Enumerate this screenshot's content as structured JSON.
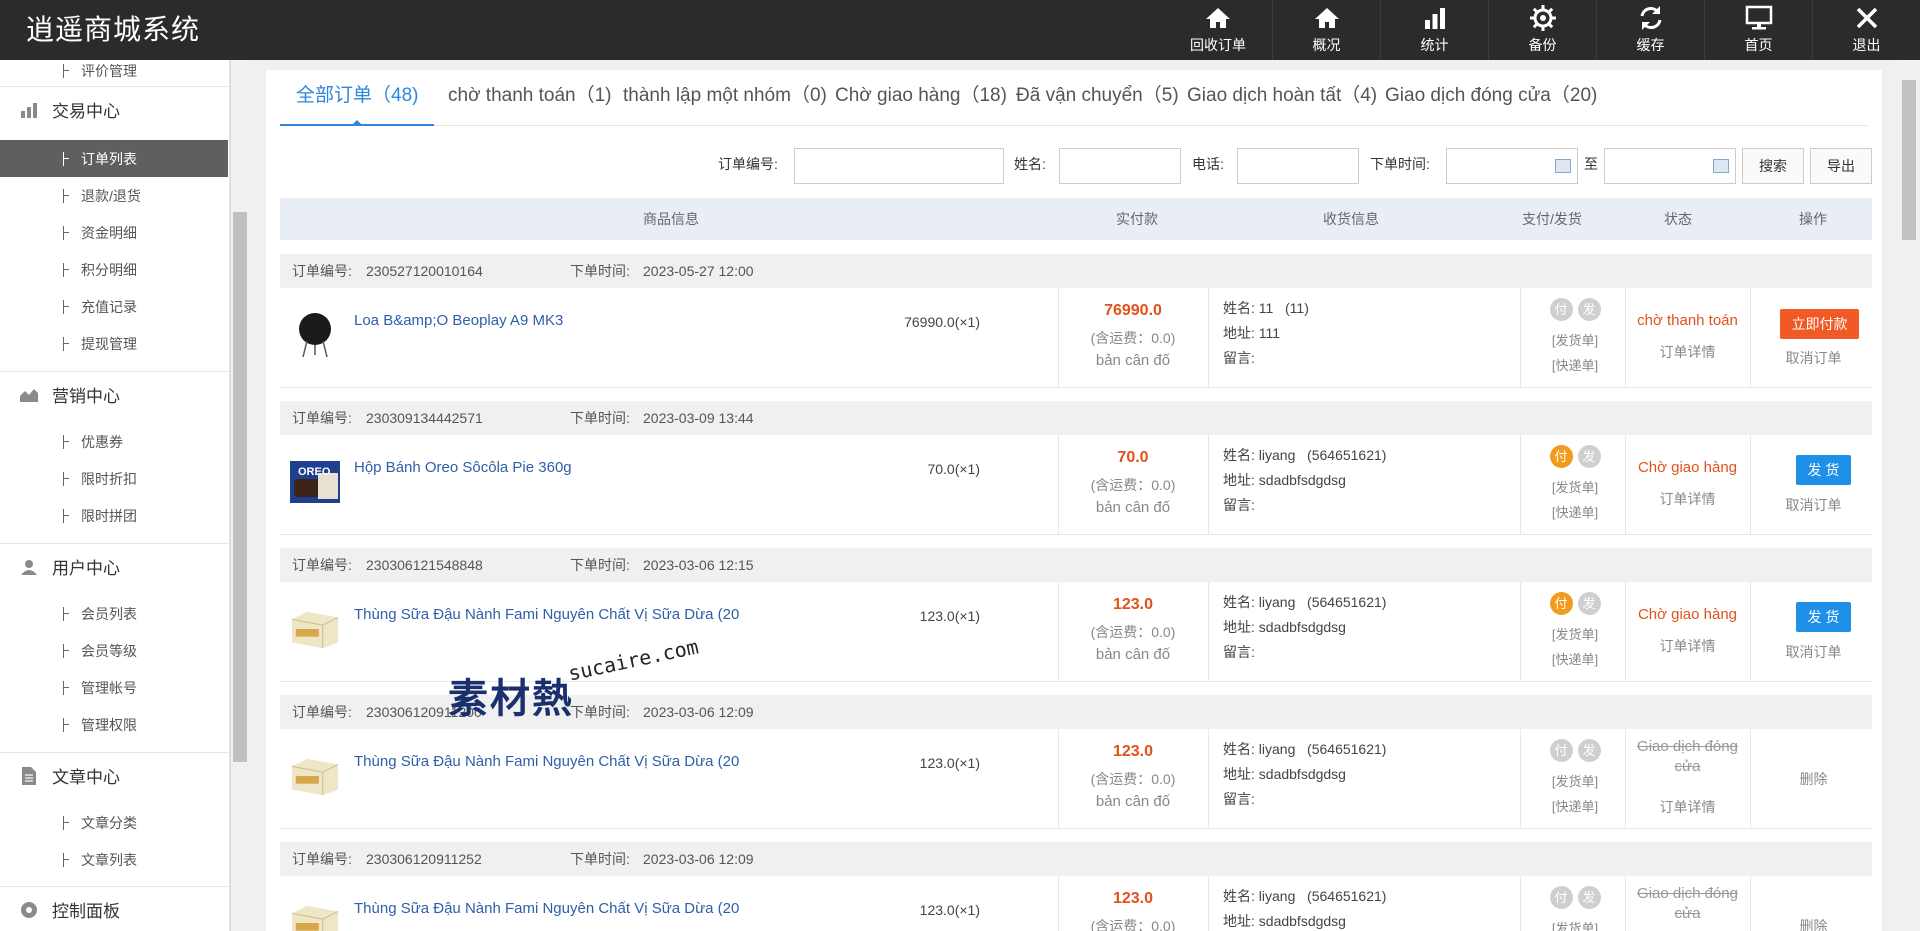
{
  "header": {
    "title": "逍遥商城系统",
    "nav": [
      {
        "label": "回收订单",
        "icon": "home-icon"
      },
      {
        "label": "概况",
        "icon": "home-icon"
      },
      {
        "label": "统计",
        "icon": "bar-chart-icon"
      },
      {
        "label": "备份",
        "icon": "gear-icon"
      },
      {
        "label": "缓存",
        "icon": "refresh-icon"
      },
      {
        "label": "首页",
        "icon": "monitor-icon"
      },
      {
        "label": "退出",
        "icon": "close-icon"
      }
    ]
  },
  "sidebar": {
    "cut_item": "评价管理",
    "groups": [
      {
        "label": "交易中心",
        "icon": "bar-chart-icon",
        "items": [
          "订单列表",
          "退款/退货",
          "资金明细",
          "积分明细",
          "充值记录",
          "提现管理"
        ]
      },
      {
        "label": "营销中心",
        "icon": "area-chart-icon",
        "items": [
          "优惠券",
          "限时折扣",
          "限时拼团"
        ]
      },
      {
        "label": "用户中心",
        "icon": "user-icon",
        "items": [
          "会员列表",
          "会员等级",
          "管理帐号",
          "管理权限"
        ]
      },
      {
        "label": "文章中心",
        "icon": "document-icon",
        "items": [
          "文章分类",
          "文章列表"
        ]
      },
      {
        "label": "控制面板",
        "icon": "dashboard-icon",
        "items": []
      }
    ],
    "active_item": "订单列表"
  },
  "tabs": [
    {
      "label": "全部订单（48)",
      "active": true
    },
    {
      "label": "chờ thanh toán（1)"
    },
    {
      "label": "thành lập một nhóm（0)"
    },
    {
      "label": "Chờ giao hàng（18)"
    },
    {
      "label": "Đã vận chuyển（5)"
    },
    {
      "label": "Giao dịch hoàn tất（4)"
    },
    {
      "label": "Giao dịch đóng cửa（20)"
    }
  ],
  "filters": {
    "order_no_label": "订单编号:",
    "name_label": "姓名:",
    "phone_label": "电话:",
    "time_label": "下单时间:",
    "to_label": "至",
    "search_button": "搜索",
    "export_button": "导出"
  },
  "table_headers": [
    "商品信息",
    "实付款",
    "收货信息",
    "支付/发货",
    "状态",
    "操作"
  ],
  "common": {
    "order_no_prefix": "订单编号:",
    "order_time_prefix": "下单时间:",
    "fee_text": "(含运费：0.0)",
    "balance_text": "bản cân đố",
    "name_prefix": "姓名:",
    "addr_prefix": "地址:",
    "msg_prefix": "留言:",
    "pay_dot": "付",
    "ship_dot": "发",
    "ship_bill": "[发货单]",
    "express_bill": "[快递单]",
    "order_detail": "订单详情",
    "cancel_order": "取消订单",
    "delete": "删除"
  },
  "orders": [
    {
      "order_no": "230527120010164",
      "order_time": "2023-05-27 12:00",
      "product": "Loa B&amp;O Beoplay A9 MK3",
      "price_qty": "76990.0(×1)",
      "paid": "76990.0",
      "recv_name": "11",
      "recv_phone": "(11)",
      "addr": "111",
      "paid_flag": false,
      "status": "chờ thanh toán",
      "status_style": "orange",
      "action_button": "立即付款",
      "action_color": "#f25a25"
    },
    {
      "order_no": "230309134442571",
      "order_time": "2023-03-09 13:44",
      "product": "Hộp Bánh Oreo Sôcôla Pie 360g",
      "price_qty": "70.0(×1)",
      "paid": "70.0",
      "recv_name": "liyang",
      "recv_phone": "(564651621)",
      "addr": "sdadbfsdgdsg",
      "paid_flag": true,
      "status": "Chờ giao hàng",
      "status_style": "orange",
      "action_button": "发 货",
      "action_color": "#1e90e8"
    },
    {
      "order_no": "230306121548848",
      "order_time": "2023-03-06 12:15",
      "product": "Thùng Sữa Đậu Nành Fami Nguyên Chất Vị Sữa Dừa (20",
      "price_qty": "123.0(×1)",
      "paid": "123.0",
      "recv_name": "liyang",
      "recv_phone": "(564651621)",
      "addr": "sdadbfsdgdsg",
      "paid_flag": true,
      "status": "Chờ giao hàng",
      "status_style": "orange",
      "action_button": "发 货",
      "action_color": "#1e90e8"
    },
    {
      "order_no": "230306120911200",
      "order_time": "2023-03-06 12:09",
      "product": "Thùng Sữa Đậu Nành Fami Nguyên Chất Vị Sữa Dừa (20",
      "price_qty": "123.0(×1)",
      "paid": "123.0",
      "recv_name": "liyang",
      "recv_phone": "(564651621)",
      "addr": "sdadbfsdgdsg",
      "paid_flag": false,
      "status": "Giao dịch đóng cửa",
      "status_style": "gray",
      "action_button": "",
      "action_color": ""
    },
    {
      "order_no": "230306120911252",
      "order_time": "2023-03-06 12:09",
      "product": "Thùng Sữa Đậu Nành Fami Nguyên Chất Vị Sữa Dừa (20",
      "price_qty": "123.0(×1)",
      "paid": "123.0",
      "recv_name": "liyang",
      "recv_phone": "(564651621)",
      "addr": "sdadbfsdgdsg",
      "paid_flag": false,
      "status": "Giao dịch đóng cửa",
      "status_style": "gray",
      "action_button": "",
      "action_color": ""
    }
  ],
  "watermark": {
    "cn": "素材熱",
    "en": "sucaire.com"
  },
  "colors": {
    "accent": "#2e86de",
    "orange": "#e3511b",
    "pay_orange": "#f29b1d",
    "topbar": "#2b2b2b"
  }
}
